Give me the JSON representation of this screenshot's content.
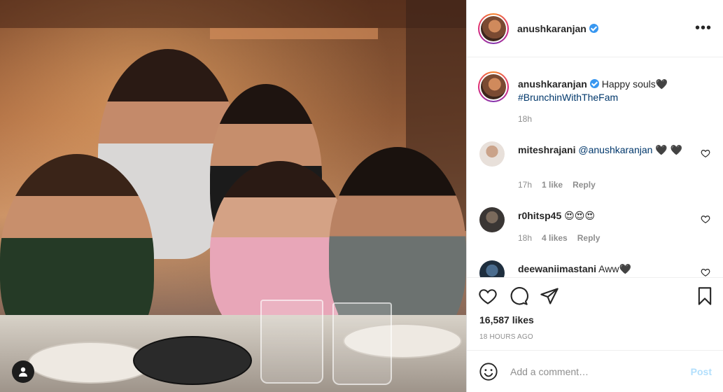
{
  "post": {
    "username": "anushkaranjan",
    "more_label": "•••",
    "caption_text": "Happy souls🖤",
    "caption_hashtag": "#BrunchinWithTheFam",
    "caption_time": "18h"
  },
  "comments": [
    {
      "username": "miteshrajani",
      "mention": "@anushkaranjan",
      "text": " 🖤 🖤",
      "time": "17h",
      "likes": "1 like",
      "reply": "Reply"
    },
    {
      "username": "r0hitsp45",
      "mention": "",
      "text": "😍😍😍",
      "time": "18h",
      "likes": "4 likes",
      "reply": "Reply"
    },
    {
      "username": "deewaniimastani",
      "mention": "",
      "text": "Aww🖤",
      "time": "",
      "likes": "",
      "reply": ""
    }
  ],
  "stats": {
    "likes": "16,587 likes",
    "time_ago": "18 HOURS AGO"
  },
  "composer": {
    "placeholder": "Add a comment…",
    "post_label": "Post"
  },
  "colors": {
    "link": "#00376b",
    "verified": "#3897f0",
    "post_disabled": "#b2dffc"
  }
}
